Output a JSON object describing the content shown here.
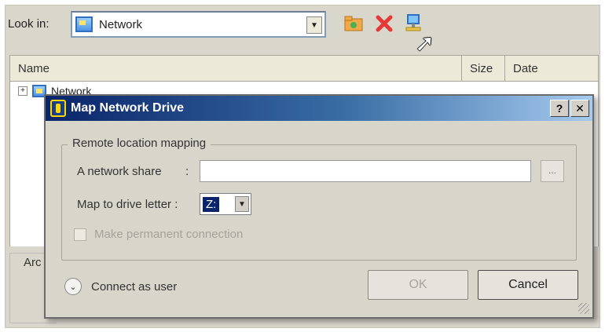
{
  "toolbar": {
    "look_in_label": "Look in:",
    "look_in_value": "Network",
    "combo_arrow": "▼",
    "icons": [
      "new-folder-icon",
      "delete-icon",
      "map-network-drive-icon"
    ]
  },
  "file_list": {
    "columns": [
      "Name",
      "Size",
      "Date"
    ],
    "tree_root": "Network"
  },
  "background": {
    "archive_label": "Arc"
  },
  "dialog": {
    "title": "Map Network Drive",
    "help_btn": "?",
    "close_btn": "✕",
    "group_title": "Remote location mapping",
    "share_label": "A network share",
    "share_sep": ":",
    "share_value": "",
    "browse_label": "...",
    "drive_label": "Map to drive letter :",
    "drive_value": "Z:",
    "permanent_label": "Make permanent connection",
    "connect_as_label": "Connect as user",
    "ok_label": "OK",
    "cancel_label": "Cancel"
  },
  "colors": {
    "title_bar_start": "#0a246a",
    "title_bar_end": "#a6caf0",
    "dialog_bg": "#d8d5cb"
  }
}
